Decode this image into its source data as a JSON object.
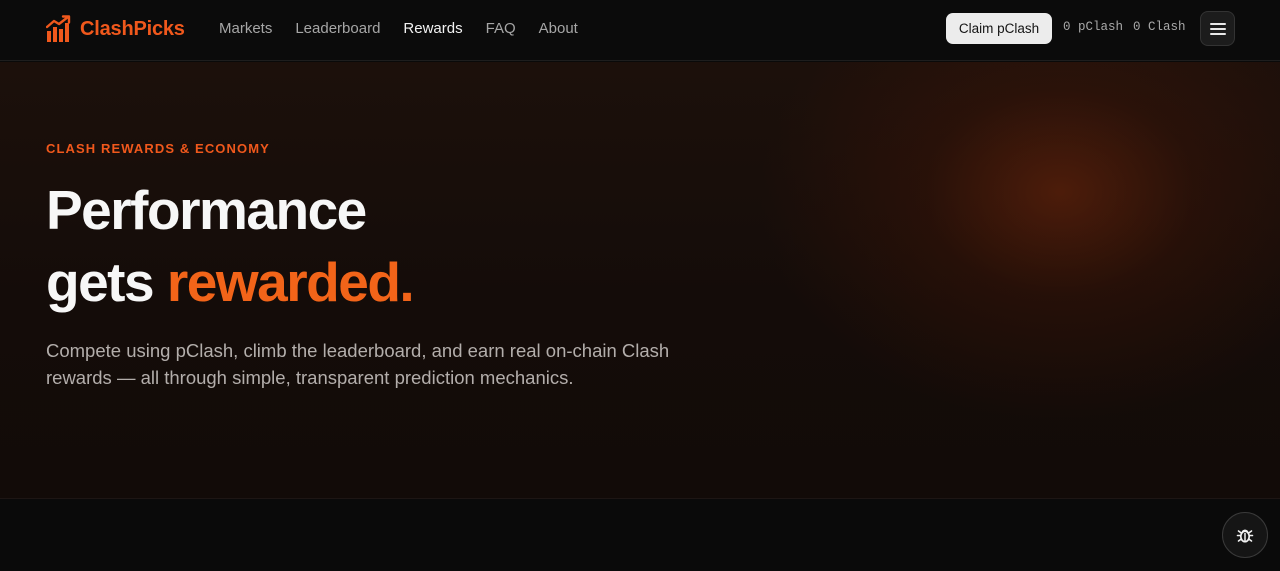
{
  "brand": {
    "name": "ClashPicks",
    "accent_color": "#f0581c",
    "logo_icon": "bar-chart-trend-icon"
  },
  "nav": {
    "items": [
      {
        "label": "Markets",
        "active": false
      },
      {
        "label": "Leaderboard",
        "active": false
      },
      {
        "label": "Rewards",
        "active": true
      },
      {
        "label": "FAQ",
        "active": false
      },
      {
        "label": "About",
        "active": false
      }
    ]
  },
  "header": {
    "claim_label": "Claim pClash",
    "pclash_balance": "0 pClash",
    "clash_balance": "0 Clash",
    "menu_icon": "hamburger-menu-icon"
  },
  "hero": {
    "eyebrow": "CLASH REWARDS & ECONOMY",
    "headline_line1": "Performance",
    "headline_line2_prefix": "gets",
    "headline_line2_accent": "rewarded.",
    "description": "Compete using pClash, climb the leaderboard, and earn real on-chain Clash rewards — all through simple, transparent prediction mechanics.",
    "accent_color": "#f26419"
  },
  "floating": {
    "bug_icon": "bug-report-icon"
  }
}
